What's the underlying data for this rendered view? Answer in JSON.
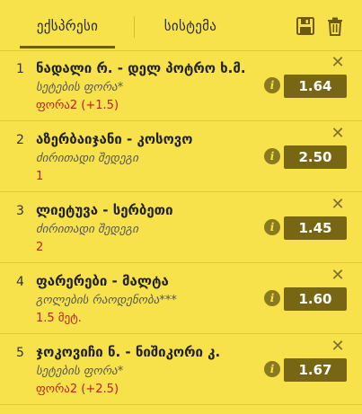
{
  "tabs": {
    "express": "ექსპრესი",
    "system": "სისტემა"
  },
  "icons": {
    "save": "save-icon",
    "trash": "trash-icon",
    "close": "close-icon",
    "info": "info-icon"
  },
  "colors": {
    "background": "#f7e24b",
    "odds_button": "#776714",
    "outcome_text": "#c0201c"
  },
  "bets": [
    {
      "number": "1",
      "match": "ნადალი რ. - დელ პოტრო ხ.მ.",
      "market": "სეტების ფორა*",
      "outcome": "ფორა2 (+1.5)",
      "odds": "1.64"
    },
    {
      "number": "2",
      "match": "აზერბაიჯანი - კოსოვო",
      "market": "ძირითადი შედეგი",
      "outcome": "1",
      "odds": "2.50"
    },
    {
      "number": "3",
      "match": "ლიეტუვა - სერბეთი",
      "market": "ძირითადი შედეგი",
      "outcome": "2",
      "odds": "1.45"
    },
    {
      "number": "4",
      "match": "ფარერები - მალტა",
      "market": "გოლების რაოდენობა***",
      "outcome": "1.5 მეტ.",
      "odds": "1.60"
    },
    {
      "number": "5",
      "match": "ჯოკოვიჩი ნ. - ნიშიკორი კ.",
      "market": "სეტების ფორა*",
      "outcome": "ფორა2 (+2.5)",
      "odds": "1.67"
    }
  ]
}
